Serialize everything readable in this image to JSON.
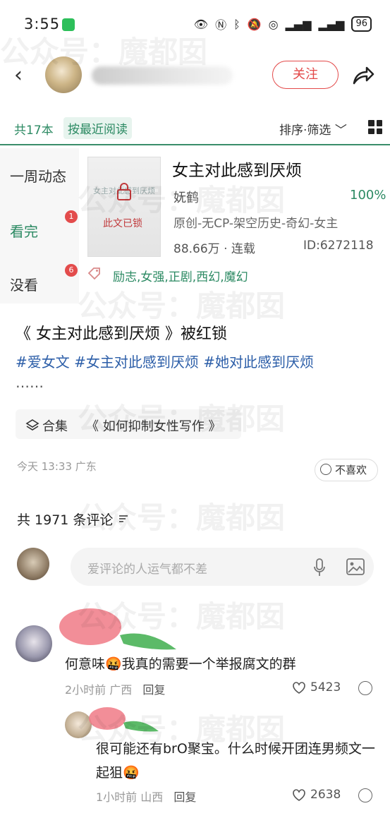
{
  "status": {
    "time": "3:55",
    "battery": "96"
  },
  "header": {
    "follow": "关注"
  },
  "filter": {
    "count": "共17本",
    "sort_mode": "按最近阅读",
    "sort_filter": "排序·筛选"
  },
  "sidebar": {
    "items": [
      {
        "label": "一周动态",
        "badge": ""
      },
      {
        "label": "看完",
        "badge": "1"
      },
      {
        "label": "没看",
        "badge": "6"
      }
    ]
  },
  "book": {
    "cover_title": "女主对此感到厌烦",
    "lock_label": "此文已锁",
    "title": "女主对此感到厌烦",
    "author": "妩鹤",
    "progress": "100%",
    "genre": "原创-无CP-架空历史-奇幻-女主",
    "words_status": "88.66万 · 连载",
    "id": "ID:6272118",
    "tags": "励志,女强,正剧,西幻,魔幻"
  },
  "post": {
    "title": "《 女主对此感到厌烦 》被红锁",
    "hashtags": "#爱女文 #女主对此感到厌烦 #她对此感到厌烦",
    "ellipsis": "……",
    "collection_label": "合集",
    "collection_title": "《 如何抑制女性写作 》",
    "meta": "今天 13:33 广东",
    "dislike": "不喜欢"
  },
  "comments_header": {
    "count": "共 1971 条评论"
  },
  "comment_input": {
    "placeholder": "爱评论的人运气都不差"
  },
  "comments": [
    {
      "text": "何意味🤬我真的需要一个举报腐文的群",
      "time_loc": "2小时前 广西",
      "reply": "回复",
      "likes": "5423"
    },
    {
      "text": "很可能还有brO聚宝。什么时候开团连男频文一起狙🤬",
      "time_loc": "1小时前 山西",
      "reply": "回复",
      "likes": "2638"
    }
  ],
  "watermark": "公众号：魔都囡",
  "colors": {
    "accent": "#2c8a63",
    "follow_red": "#e34949",
    "hashtag_blue": "#2c5ea8"
  }
}
